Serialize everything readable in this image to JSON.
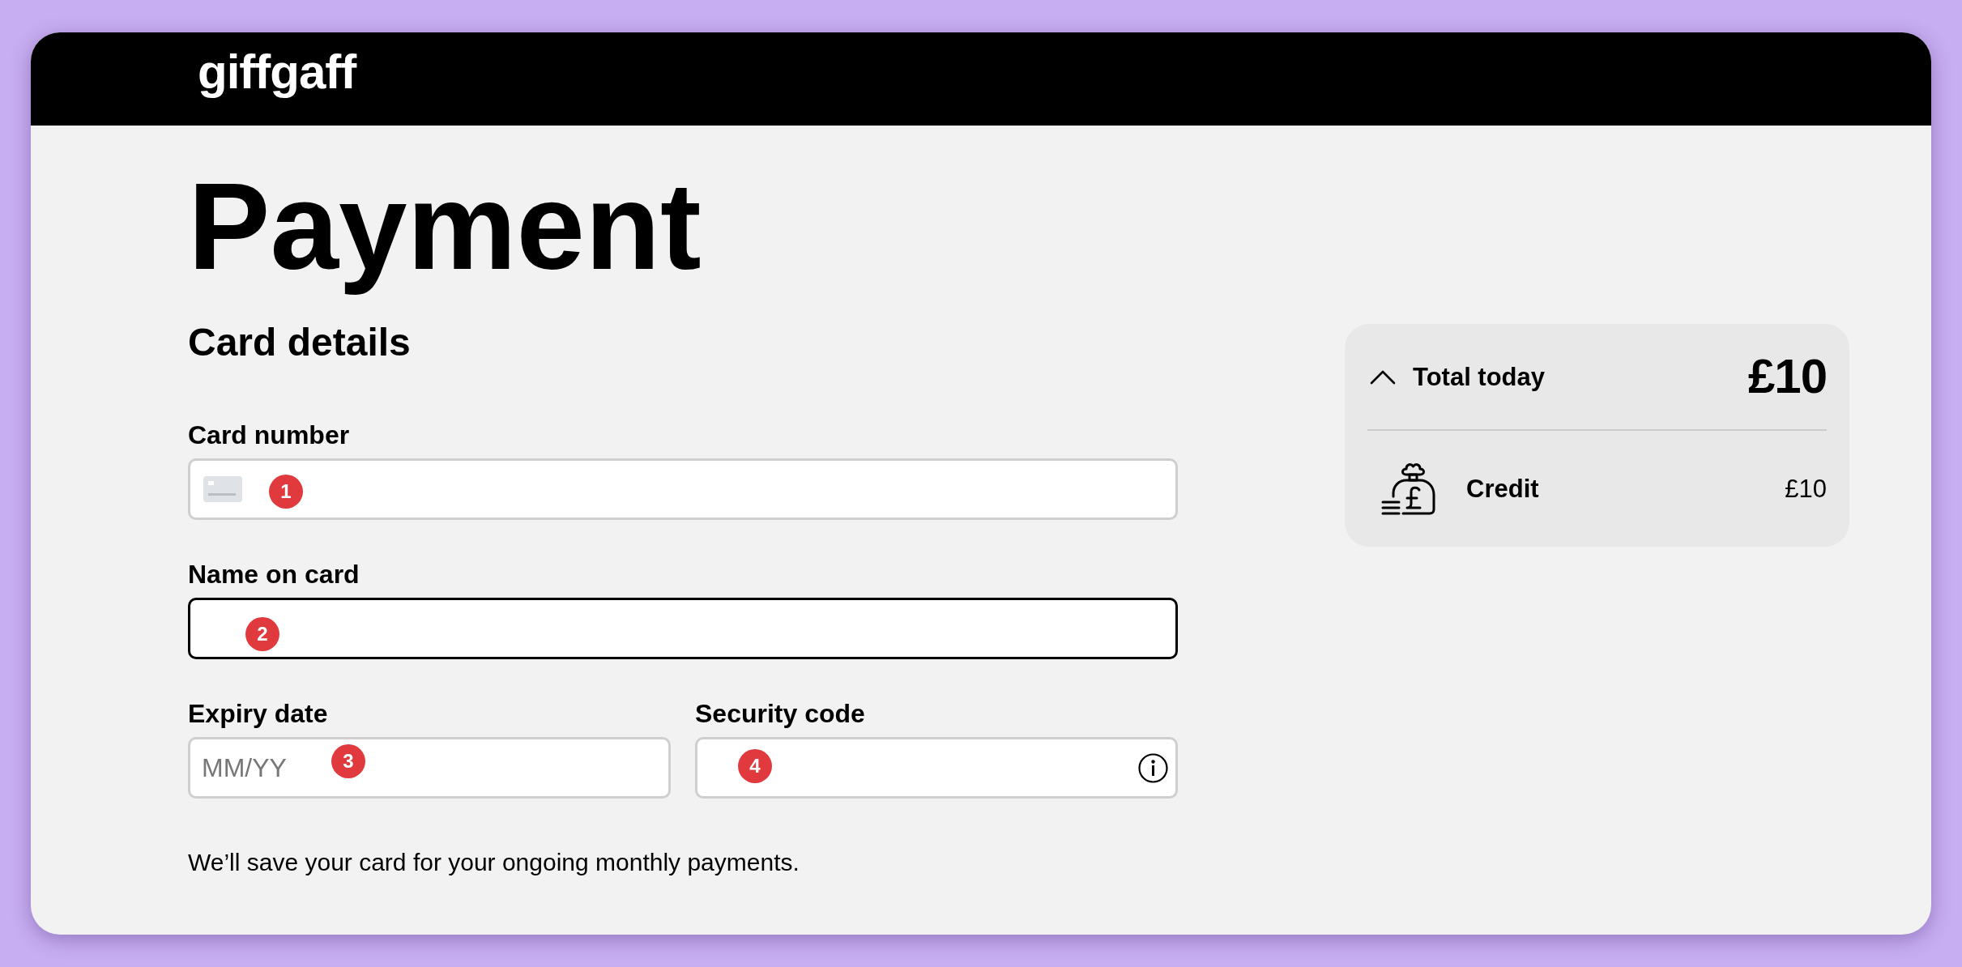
{
  "header": {
    "logo": "giffgaff"
  },
  "page": {
    "title": "Payment"
  },
  "card_details": {
    "heading": "Card details",
    "rows": [
      {
        "fields": [
          {
            "label": "Card number",
            "kind": "card",
            "focused": false,
            "marker": "1"
          }
        ]
      },
      {
        "fields": [
          {
            "label": "Name on card",
            "kind": "text",
            "focused": true,
            "marker": "2"
          }
        ]
      },
      {
        "fields": [
          {
            "label": "Expiry date",
            "kind": "expiry",
            "focused": false,
            "placeholder": "MM/YY",
            "marker": "3"
          },
          {
            "label": "Security code",
            "kind": "cvc",
            "focused": false,
            "marker": "4"
          }
        ]
      }
    ],
    "note": "We’ll save your card for your ongoing monthly payments."
  },
  "summary": {
    "title": "Total today",
    "total": "£10",
    "expanded": true,
    "items": [
      {
        "label": "Credit",
        "amount": "£10"
      }
    ]
  }
}
